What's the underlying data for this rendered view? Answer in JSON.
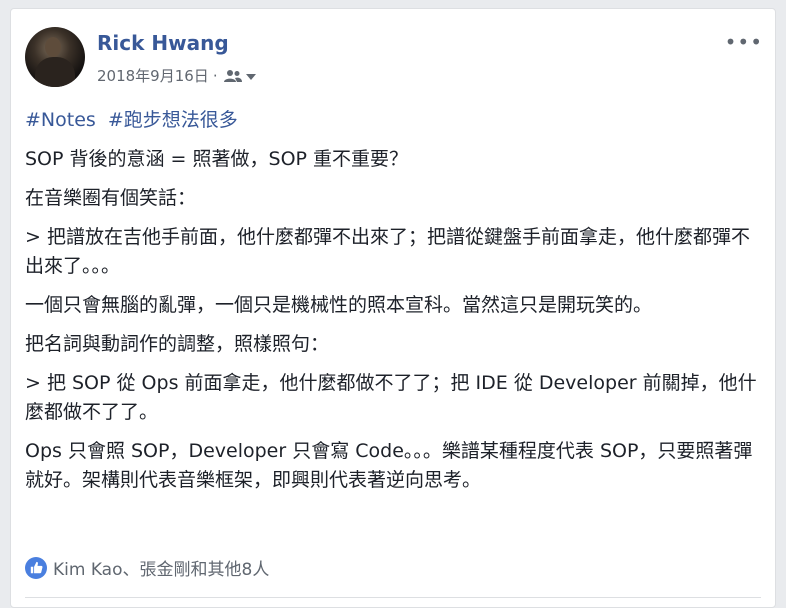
{
  "post": {
    "author": "Rick Hwang",
    "date": "2018年9月16日",
    "separator": "·",
    "audience_icon": "friends-icon",
    "more_label": "•••",
    "hashtags": [
      "#Notes",
      "#跑步想法很多"
    ],
    "paragraphs": [
      "SOP 背後的意涵 = 照著做，SOP 重不重要？",
      "在音樂圈有個笑話：",
      "> 把譜放在吉他手前面，他什麼都彈不出來了；把譜從鍵盤手前面拿走，他什麼都彈不出來了。。。",
      "一個只會無腦的亂彈，一個只是機械性的照本宣科。當然這只是開玩笑的。",
      "把名詞與動詞作的調整，照樣照句：",
      "> 把 SOP 從 Ops 前面拿走，他什麼都做不了了；把 IDE 從 Developer 前關掉，他什麼都做不了了。",
      "Ops 只會照 SOP，Developer 只會寫 Code。。。樂譜某種程度代表 SOP，只要照著彈就好。架構則代表音樂框架，即興則代表著逆向思考。"
    ],
    "reactions_text": "Kim Kao、張金剛和其他8人",
    "colors": {
      "link": "#385898",
      "like_blue": "#4a7fdf"
    }
  }
}
